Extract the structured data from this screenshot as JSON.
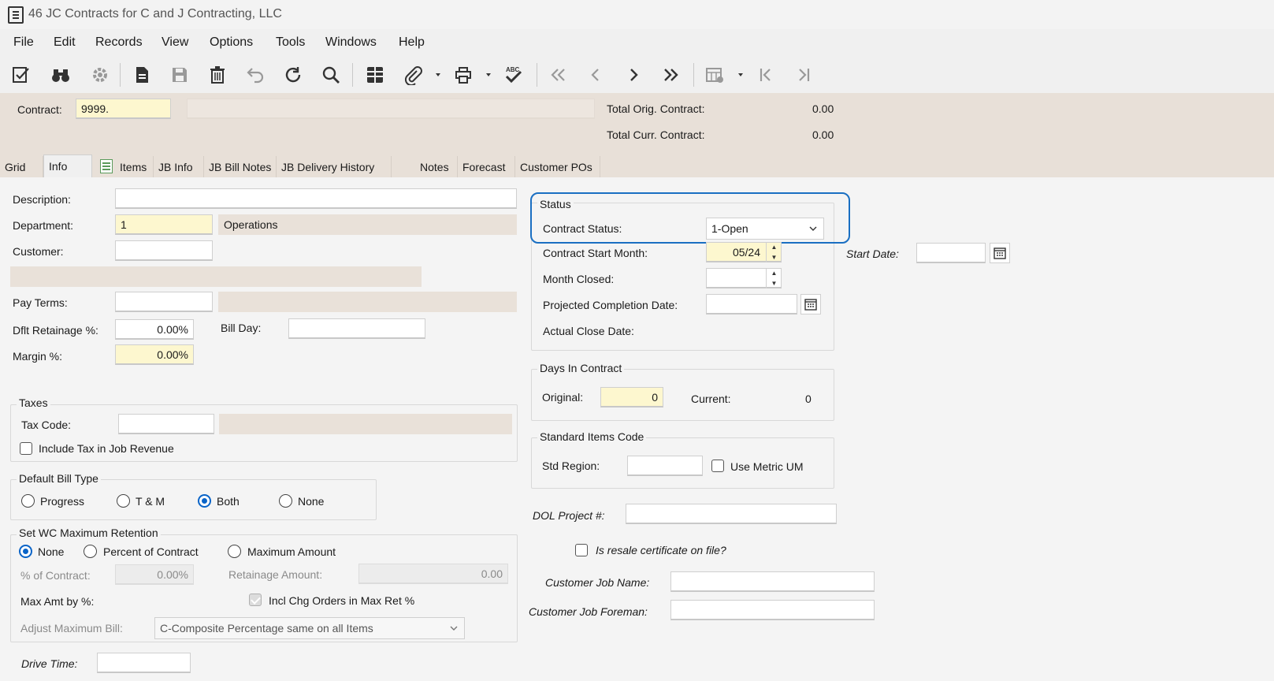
{
  "window": {
    "title": "46 JC Contracts for C and J Contracting, LLC"
  },
  "menu": [
    "File",
    "Edit",
    "Records",
    "View",
    "Options",
    "Tools",
    "Windows",
    "Help"
  ],
  "toolbar": {
    "icons": [
      "edit-check-icon",
      "binoculars-icon",
      "gear-icon",
      "new-document-icon",
      "save-icon",
      "delete-icon",
      "undo-icon",
      "refresh-icon",
      "search-icon",
      "grid-view-icon",
      "attach-icon",
      "print-icon",
      "spellcheck-icon",
      "first-record-icon",
      "previous-record-icon",
      "next-record-icon",
      "last-record-icon",
      "table-settings-icon",
      "jump-first-icon",
      "jump-last-icon"
    ]
  },
  "header": {
    "contract_label": "Contract:",
    "contract_value": "9999.",
    "total_orig_label": "Total Orig. Contract:",
    "total_orig_value": "0.00",
    "total_curr_label": "Total Curr. Contract:",
    "total_curr_value": "0.00"
  },
  "tabs": [
    "Grid",
    "Info",
    "Items",
    "JB Info",
    "JB Bill Notes",
    "JB Delivery History",
    "Notes",
    "Forecast",
    "Customer POs"
  ],
  "active_tab": "Info",
  "info": {
    "description_label": "Description:",
    "description_value": "",
    "department_label": "Department:",
    "department_value": "1",
    "department_name": "Operations",
    "customer_label": "Customer:",
    "customer_value": "",
    "pay_terms_label": "Pay Terms:",
    "dflt_retainage_label": "Dflt Retainage %:",
    "dflt_retainage_value": "0.00%",
    "bill_day_label": "Bill Day:",
    "margin_label": "Margin %:",
    "margin_value": "0.00%"
  },
  "taxes": {
    "title": "Taxes",
    "tax_code_label": "Tax Code:",
    "include_tax_label": "Include Tax in Job Revenue"
  },
  "bill_type": {
    "title": "Default Bill Type",
    "options": [
      "Progress",
      "T & M",
      "Both",
      "None"
    ],
    "selected": "Both"
  },
  "retention": {
    "title": "Set WC Maximum Retention",
    "options": [
      "None",
      "Percent of Contract",
      "Maximum Amount"
    ],
    "selected": "None",
    "pct_label": "% of Contract:",
    "pct_value": "0.00%",
    "ret_amount_label": "Retainage Amount:",
    "ret_amount_value": "0.00",
    "max_amt_label": "Max Amt by %:",
    "incl_chg_label": "Incl Chg Orders in Max Ret %",
    "adjust_label": "Adjust Maximum Bill:",
    "adjust_value": "C-Composite Percentage same on all Items"
  },
  "drive_time_label": "Drive Time:",
  "status": {
    "title": "Status",
    "contract_status_label": "Contract Status:",
    "contract_status_value": "1-Open",
    "start_month_label": "Contract Start Month:",
    "start_month_value": "05/24",
    "month_closed_label": "Month Closed:",
    "projected_label": "Projected Completion Date:",
    "actual_close_label": "Actual Close Date:"
  },
  "start_date_label": "Start Date:",
  "days": {
    "title": "Days In Contract",
    "original_label": "Original:",
    "original_value": "0",
    "current_label": "Current:",
    "current_value": "0"
  },
  "std_items": {
    "title": "Standard Items Code",
    "region_label": "Std Region:",
    "metric_label": "Use Metric UM"
  },
  "dol_label": "DOL Project #:",
  "resale_label": "Is resale certificate on file?",
  "customer_job_name_label": "Customer Job Name:",
  "customer_job_foreman_label": "Customer Job Foreman:"
}
